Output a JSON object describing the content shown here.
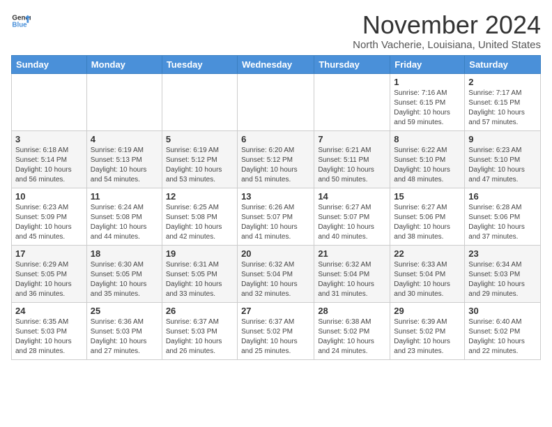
{
  "header": {
    "logo_line1": "General",
    "logo_line2": "Blue",
    "month": "November 2024",
    "location": "North Vacherie, Louisiana, United States"
  },
  "weekdays": [
    "Sunday",
    "Monday",
    "Tuesday",
    "Wednesday",
    "Thursday",
    "Friday",
    "Saturday"
  ],
  "weeks": [
    [
      {
        "day": "",
        "info": ""
      },
      {
        "day": "",
        "info": ""
      },
      {
        "day": "",
        "info": ""
      },
      {
        "day": "",
        "info": ""
      },
      {
        "day": "",
        "info": ""
      },
      {
        "day": "1",
        "info": "Sunrise: 7:16 AM\nSunset: 6:15 PM\nDaylight: 10 hours\nand 59 minutes."
      },
      {
        "day": "2",
        "info": "Sunrise: 7:17 AM\nSunset: 6:15 PM\nDaylight: 10 hours\nand 57 minutes."
      }
    ],
    [
      {
        "day": "3",
        "info": "Sunrise: 6:18 AM\nSunset: 5:14 PM\nDaylight: 10 hours\nand 56 minutes."
      },
      {
        "day": "4",
        "info": "Sunrise: 6:19 AM\nSunset: 5:13 PM\nDaylight: 10 hours\nand 54 minutes."
      },
      {
        "day": "5",
        "info": "Sunrise: 6:19 AM\nSunset: 5:12 PM\nDaylight: 10 hours\nand 53 minutes."
      },
      {
        "day": "6",
        "info": "Sunrise: 6:20 AM\nSunset: 5:12 PM\nDaylight: 10 hours\nand 51 minutes."
      },
      {
        "day": "7",
        "info": "Sunrise: 6:21 AM\nSunset: 5:11 PM\nDaylight: 10 hours\nand 50 minutes."
      },
      {
        "day": "8",
        "info": "Sunrise: 6:22 AM\nSunset: 5:10 PM\nDaylight: 10 hours\nand 48 minutes."
      },
      {
        "day": "9",
        "info": "Sunrise: 6:23 AM\nSunset: 5:10 PM\nDaylight: 10 hours\nand 47 minutes."
      }
    ],
    [
      {
        "day": "10",
        "info": "Sunrise: 6:23 AM\nSunset: 5:09 PM\nDaylight: 10 hours\nand 45 minutes."
      },
      {
        "day": "11",
        "info": "Sunrise: 6:24 AM\nSunset: 5:08 PM\nDaylight: 10 hours\nand 44 minutes."
      },
      {
        "day": "12",
        "info": "Sunrise: 6:25 AM\nSunset: 5:08 PM\nDaylight: 10 hours\nand 42 minutes."
      },
      {
        "day": "13",
        "info": "Sunrise: 6:26 AM\nSunset: 5:07 PM\nDaylight: 10 hours\nand 41 minutes."
      },
      {
        "day": "14",
        "info": "Sunrise: 6:27 AM\nSunset: 5:07 PM\nDaylight: 10 hours\nand 40 minutes."
      },
      {
        "day": "15",
        "info": "Sunrise: 6:27 AM\nSunset: 5:06 PM\nDaylight: 10 hours\nand 38 minutes."
      },
      {
        "day": "16",
        "info": "Sunrise: 6:28 AM\nSunset: 5:06 PM\nDaylight: 10 hours\nand 37 minutes."
      }
    ],
    [
      {
        "day": "17",
        "info": "Sunrise: 6:29 AM\nSunset: 5:05 PM\nDaylight: 10 hours\nand 36 minutes."
      },
      {
        "day": "18",
        "info": "Sunrise: 6:30 AM\nSunset: 5:05 PM\nDaylight: 10 hours\nand 35 minutes."
      },
      {
        "day": "19",
        "info": "Sunrise: 6:31 AM\nSunset: 5:05 PM\nDaylight: 10 hours\nand 33 minutes."
      },
      {
        "day": "20",
        "info": "Sunrise: 6:32 AM\nSunset: 5:04 PM\nDaylight: 10 hours\nand 32 minutes."
      },
      {
        "day": "21",
        "info": "Sunrise: 6:32 AM\nSunset: 5:04 PM\nDaylight: 10 hours\nand 31 minutes."
      },
      {
        "day": "22",
        "info": "Sunrise: 6:33 AM\nSunset: 5:04 PM\nDaylight: 10 hours\nand 30 minutes."
      },
      {
        "day": "23",
        "info": "Sunrise: 6:34 AM\nSunset: 5:03 PM\nDaylight: 10 hours\nand 29 minutes."
      }
    ],
    [
      {
        "day": "24",
        "info": "Sunrise: 6:35 AM\nSunset: 5:03 PM\nDaylight: 10 hours\nand 28 minutes."
      },
      {
        "day": "25",
        "info": "Sunrise: 6:36 AM\nSunset: 5:03 PM\nDaylight: 10 hours\nand 27 minutes."
      },
      {
        "day": "26",
        "info": "Sunrise: 6:37 AM\nSunset: 5:03 PM\nDaylight: 10 hours\nand 26 minutes."
      },
      {
        "day": "27",
        "info": "Sunrise: 6:37 AM\nSunset: 5:02 PM\nDaylight: 10 hours\nand 25 minutes."
      },
      {
        "day": "28",
        "info": "Sunrise: 6:38 AM\nSunset: 5:02 PM\nDaylight: 10 hours\nand 24 minutes."
      },
      {
        "day": "29",
        "info": "Sunrise: 6:39 AM\nSunset: 5:02 PM\nDaylight: 10 hours\nand 23 minutes."
      },
      {
        "day": "30",
        "info": "Sunrise: 6:40 AM\nSunset: 5:02 PM\nDaylight: 10 hours\nand 22 minutes."
      }
    ]
  ]
}
